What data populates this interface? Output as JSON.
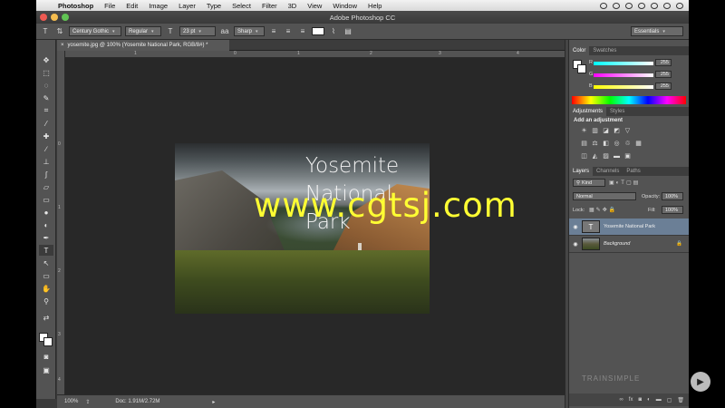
{
  "menubar": {
    "app": "Photoshop",
    "items": [
      "File",
      "Edit",
      "Image",
      "Layer",
      "Type",
      "Select",
      "Filter",
      "3D",
      "View",
      "Window",
      "Help"
    ]
  },
  "titlebar": {
    "title": "Adobe Photoshop CC"
  },
  "options": {
    "font_family": "Century Gothic",
    "font_style": "Regular",
    "font_size": "23 pt",
    "antialias_icon": "aa",
    "antialias": "Sharp",
    "workspace": "Essentials"
  },
  "document": {
    "tab_label": "yosemite.jpg @ 100% (Yosemite National  Park, RGB/8#) *",
    "ruler_h": [
      "1",
      "0",
      "1",
      "2",
      "3",
      "4"
    ],
    "ruler_v": [
      "0",
      "1",
      "2",
      "3",
      "4"
    ],
    "photo_text": [
      "Yosemite",
      "National",
      "Park"
    ],
    "watermark": "www.cgtsj.com"
  },
  "status": {
    "zoom": "100%",
    "doc": "Doc: 1.91M/2.72M"
  },
  "color_panel": {
    "tabs": [
      "Color",
      "Swatches"
    ],
    "r_label": "R",
    "r_value": "255",
    "g_label": "G",
    "g_value": "255",
    "b_label": "B",
    "b_value": "255"
  },
  "adjustments_panel": {
    "tabs": [
      "Adjustments",
      "Styles"
    ],
    "heading": "Add an adjustment"
  },
  "layers_panel": {
    "tabs": [
      "Layers",
      "Channels",
      "Paths"
    ],
    "filter": "Kind",
    "blend_mode": "Normal",
    "opacity_label": "Opacity:",
    "opacity_value": "100%",
    "lock_label": "Lock:",
    "fill_label": "Fill:",
    "fill_value": "100%",
    "layers": [
      {
        "name": "Yosemite National  Park"
      },
      {
        "name": "Background"
      }
    ],
    "footer_icons": [
      "link-icon",
      "fx-icon",
      "mask-icon",
      "adjustment-icon",
      "folder-icon",
      "new-layer-icon",
      "trash-icon"
    ]
  },
  "branding": {
    "trainsimple": "TRAINSIMPLE"
  },
  "colors": {
    "accent": "#6b7f96",
    "watermark": "#ffff33"
  }
}
